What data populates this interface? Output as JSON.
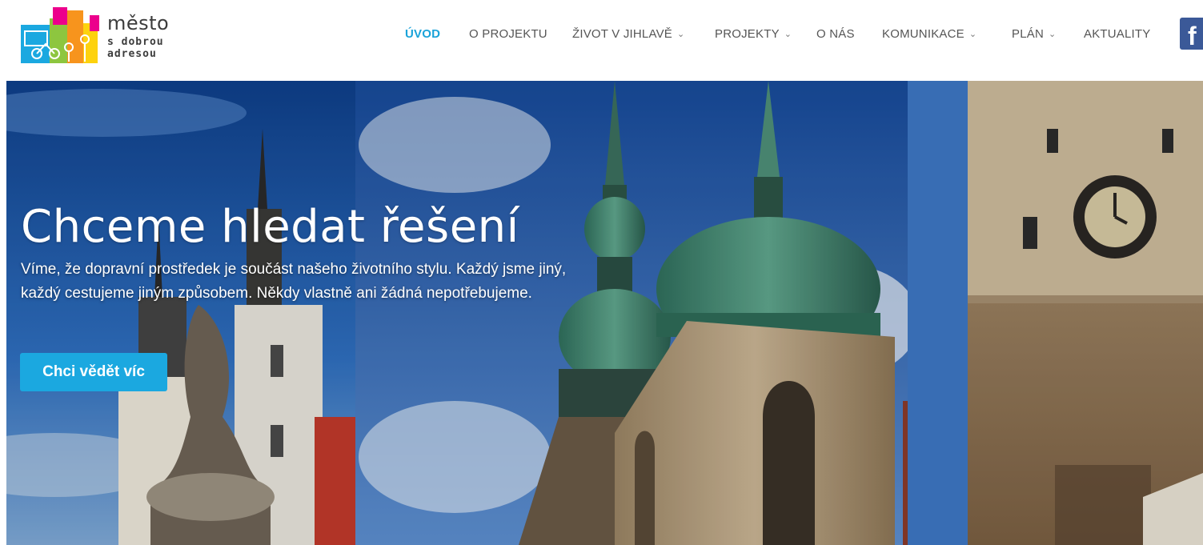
{
  "brand": {
    "line1": "město",
    "line2": "s dobrou",
    "line3": "adresou",
    "logo_colors": [
      "#1ba8e0",
      "#8dc63f",
      "#f7941d",
      "#ec008c",
      "#fdd20e"
    ]
  },
  "nav": {
    "items": [
      {
        "label": "ÚVOD",
        "active": true,
        "has_dropdown": false
      },
      {
        "label": "O PROJEKTU",
        "active": false,
        "has_dropdown": false
      },
      {
        "label": "ŽIVOT V JIHLAVĚ",
        "active": false,
        "has_dropdown": true
      },
      {
        "label": "PROJEKTY",
        "active": false,
        "has_dropdown": true
      },
      {
        "label": "O NÁS",
        "active": false,
        "has_dropdown": false
      },
      {
        "label": "KOMUNIKACE",
        "active": false,
        "has_dropdown": true
      },
      {
        "label": "PLÁN",
        "active": false,
        "has_dropdown": true
      },
      {
        "label": "AKTUALITY",
        "active": false,
        "has_dropdown": false
      }
    ],
    "chevron": "⌄",
    "facebook_icon": "facebook-icon",
    "facebook_glyph": "f"
  },
  "hero": {
    "title": "Chceme hledat řešení",
    "text": "Víme, že dopravní prostředek je součást našeho životního stylu. Každý jsme jiný, každý cestujeme jiným způsobem. Někdy vlastně ani žádná nepotřebujeme.",
    "button_label": "Chci vědět víc"
  },
  "colors": {
    "accent": "#1ba8e0",
    "active_nav": "#1aa3d9",
    "facebook": "#3b5998"
  }
}
